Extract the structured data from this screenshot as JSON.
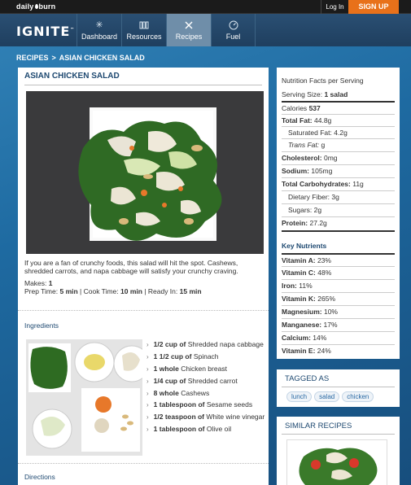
{
  "topbar": {
    "brand_part1": "daily",
    "brand_part2": "burn",
    "login_label": "Log In",
    "signup_label": "SIGN UP"
  },
  "header": {
    "logo_text": "IGNITE",
    "logo_mark": "™",
    "nav": [
      {
        "label": "Dashboard",
        "icon": "sun-burst-icon"
      },
      {
        "label": "Resources",
        "icon": "books-icon"
      },
      {
        "label": "Recipes",
        "icon": "fork-knife-icon"
      },
      {
        "label": "Fuel",
        "icon": "gauge-icon"
      }
    ],
    "active_tab": "Recipes"
  },
  "breadcrumb": {
    "root": "RECIPES",
    "separator": ">",
    "current": "ASIAN CHICKEN SALAD"
  },
  "recipe": {
    "title": "ASIAN CHICKEN SALAD",
    "description": "If you are a fan of crunchy foods, this salad will hit the spot. Cashews, shredded carrots, and napa cabbage will satisfy your crunchy craving.",
    "makes_label": "Makes:",
    "makes_value": "1",
    "prep_label": "Prep Time:",
    "prep_value": "5 min",
    "cook_label": "Cook Time:",
    "cook_value": "10 min",
    "ready_label": "Ready In:",
    "ready_value": "15 min",
    "ingredients_heading": "Ingredients",
    "directions_heading": "Directions",
    "ingredients": [
      {
        "qty": "1/2 cup of",
        "item": "Shredded napa cabbage"
      },
      {
        "qty": "1 1/2 cup of",
        "item": "Spinach"
      },
      {
        "qty": "1 whole",
        "item": "Chicken breast"
      },
      {
        "qty": "1/4 cup of",
        "item": "Shredded carrot"
      },
      {
        "qty": "8 whole",
        "item": "Cashews"
      },
      {
        "qty": "1 tablespoon of",
        "item": "Sesame seeds"
      },
      {
        "qty": "1/2 teaspoon of",
        "item": "White wine vinegar"
      },
      {
        "qty": "1 tablespoon of",
        "item": "Olive oil"
      }
    ]
  },
  "nutrition": {
    "title": "Nutrition Facts per Serving",
    "serving_label": "Serving Size:",
    "serving_value": "1 salad",
    "rows": [
      {
        "label": "Calories",
        "value": "537",
        "bold_label": false,
        "bold_value": true
      },
      {
        "label": "Total Fat:",
        "value": "44.8g",
        "bold_label": true
      },
      {
        "label": "Saturated Fat:",
        "value": "4.2g",
        "indent": true
      },
      {
        "label": "Trans Fat:",
        "value": "g",
        "indent": true,
        "italic": true
      },
      {
        "label": "Cholesterol:",
        "value": "0mg",
        "bold_label": true
      },
      {
        "label": "Sodium:",
        "value": "105mg",
        "bold_label": true
      },
      {
        "label": "Total Carbohydrates:",
        "value": "11g",
        "bold_label": true
      },
      {
        "label": "Dietary Fiber:",
        "value": "3g",
        "indent": true
      },
      {
        "label": "Sugars:",
        "value": "2g",
        "indent": true
      },
      {
        "label": "Protein:",
        "value": "27.2g",
        "bold_label": true
      }
    ],
    "key_heading": "Key Nutrients",
    "key_rows": [
      {
        "label": "Vitamin A:",
        "value": "23%"
      },
      {
        "label": "Vitamin C:",
        "value": "48%"
      },
      {
        "label": "Iron:",
        "value": "11%"
      },
      {
        "label": "Vitamin K:",
        "value": "265%"
      },
      {
        "label": "Magnesium:",
        "value": "10%"
      },
      {
        "label": "Manganese:",
        "value": "17%"
      },
      {
        "label": "Calcium:",
        "value": "14%"
      },
      {
        "label": "Vitamin E:",
        "value": "24%"
      }
    ]
  },
  "tagged": {
    "title": "TAGGED AS",
    "tags": [
      "lunch",
      "salad",
      "chicken"
    ]
  },
  "similar": {
    "title": "SIMILAR RECIPES"
  },
  "colors": {
    "accent": "#e8711a",
    "heading_blue": "#1d4870",
    "link_blue": "#2a6aa4"
  }
}
